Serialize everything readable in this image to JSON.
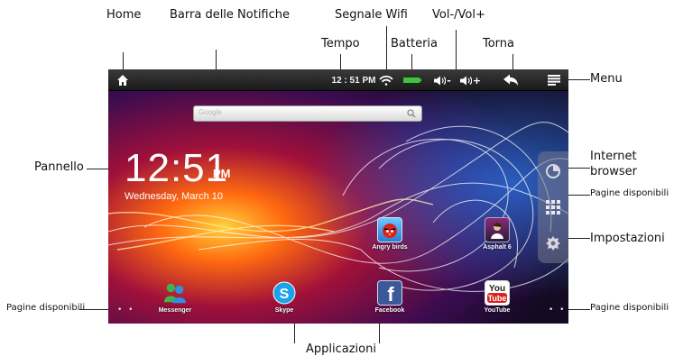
{
  "labels": {
    "home": "Home",
    "notifications_bar": "Barra delle Notifiche",
    "wifi_signal": "Segnale Wifi",
    "volume": "Vol-/Vol+",
    "time": "Tempo",
    "battery": "Batteria",
    "back": "Torna",
    "menu": "Menu",
    "panel": "Pannello",
    "internet_browser": "Internet browser",
    "pages_available_right_top": "Pagine disponibili",
    "settings": "Impostazioni",
    "pages_available_left": "Pagine disponibili",
    "pages_available_right_bottom": "Pagine disponibili",
    "applications": "Applicazioni"
  },
  "statusbar": {
    "clock": "12 : 51 PM",
    "vol_minus": "-",
    "vol_plus": "+"
  },
  "search": {
    "placeholder": "Google"
  },
  "clock_widget": {
    "time": "12:51",
    "ampm": "PM",
    "date": "Wednesday, March 10"
  },
  "apps": [
    {
      "label": "Angry birds",
      "icon": "angry-birds-icon"
    },
    {
      "label": "Asphalt 6",
      "icon": "asphalt-icon"
    },
    {
      "label": "Messenger",
      "icon": "messenger-icon"
    },
    {
      "label": "Skype",
      "icon": "skype-icon"
    },
    {
      "label": "Facebook",
      "icon": "facebook-icon"
    },
    {
      "label": "YouTube",
      "icon": "youtube-icon"
    }
  ],
  "colors": {
    "statusbar": "#222222",
    "battery": "#3cc63c"
  }
}
